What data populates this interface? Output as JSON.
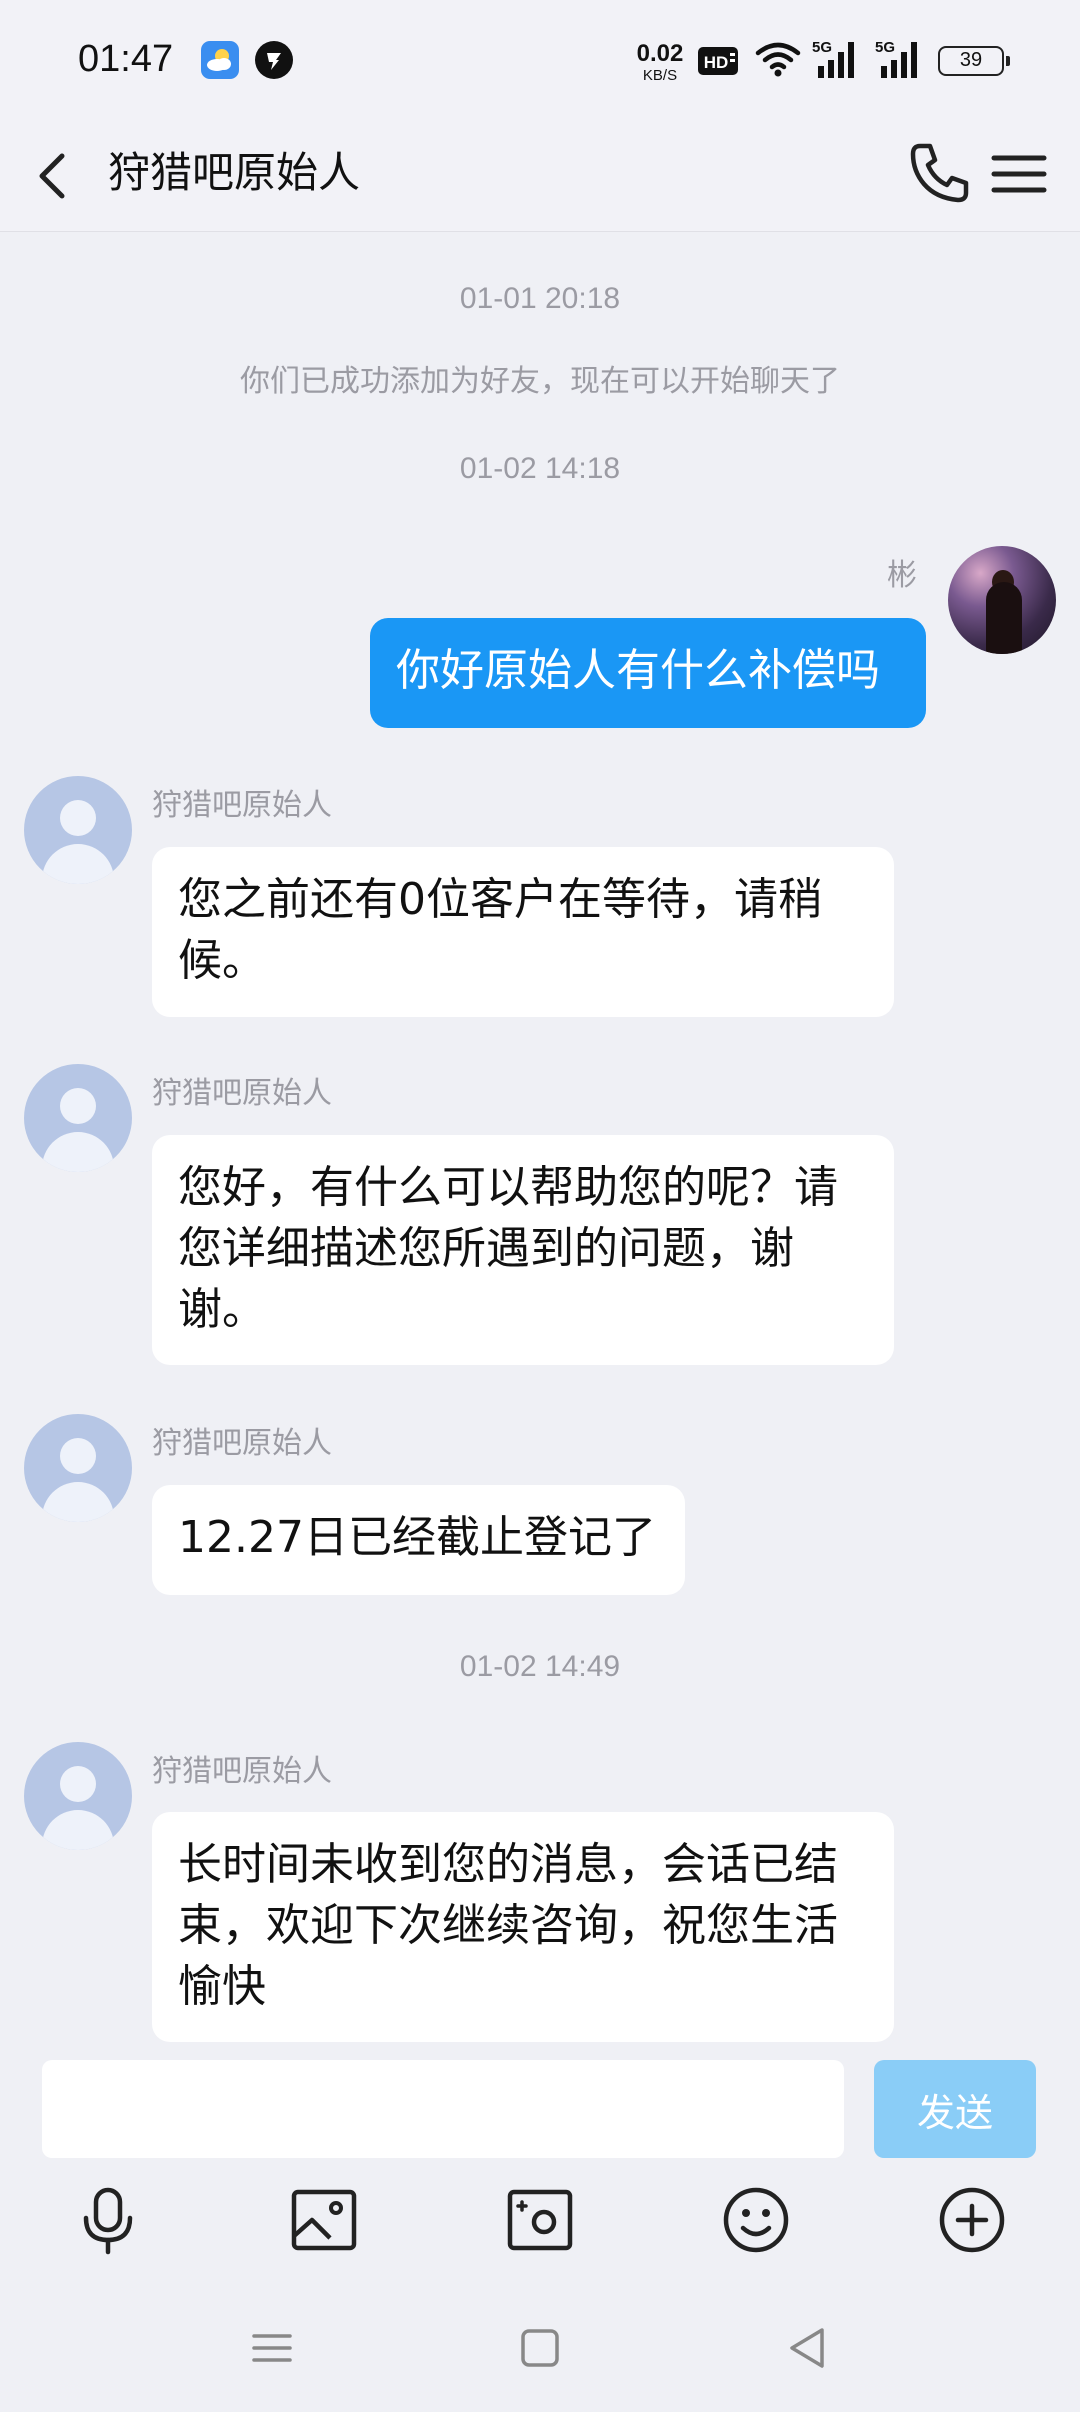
{
  "status_bar": {
    "time": "01:47",
    "net_speed_value": "0.02",
    "net_speed_unit": "KB/S",
    "hd_label": "HD",
    "signal_label": "5G",
    "battery": "39",
    "icons": [
      "weather-icon",
      "app-notification-icon",
      "wifi-icon",
      "signal-icon",
      "battery-icon"
    ]
  },
  "header": {
    "title": "狩猎吧原始人",
    "icons": [
      "back-icon",
      "phone-icon",
      "menu-icon"
    ]
  },
  "chat": {
    "timestamps": [
      "01-01 20:18",
      "01-02 14:18",
      "01-02 14:49"
    ],
    "system_message": "你们已成功添加为好友，现在可以开始聊天了",
    "self_name": "彬",
    "self_message": "你好原始人有什么补偿吗",
    "contact_name": "狩猎吧原始人",
    "incoming": [
      {
        "sender": "狩猎吧原始人",
        "text": "您之前还有0位客户在等待，请稍候。"
      },
      {
        "sender": "狩猎吧原始人",
        "text": "您好，有什么可以帮助您的呢？请您详细描述您所遇到的问题，谢谢。"
      },
      {
        "sender": "狩猎吧原始人",
        "text": "12.27日已经截止登记了"
      },
      {
        "sender": "狩猎吧原始人",
        "text": "长时间未收到您的消息，会话已结束，欢迎下次继续咨询，祝您生活愉快"
      }
    ]
  },
  "input": {
    "value": "",
    "placeholder": "",
    "send_label": "发送"
  },
  "toolbar": {
    "items": [
      "voice-icon",
      "image-icon",
      "camera-icon",
      "emoji-icon",
      "more-icon"
    ]
  },
  "nav_bar": {
    "items": [
      "recents-icon",
      "home-icon",
      "back-nav-icon"
    ]
  },
  "colors": {
    "accent": "#1a97f5",
    "send_disabled": "#8acdf7",
    "background": "#eff0f5",
    "bubble_in": "#ffffff",
    "meta_text": "#9b9ba3"
  }
}
